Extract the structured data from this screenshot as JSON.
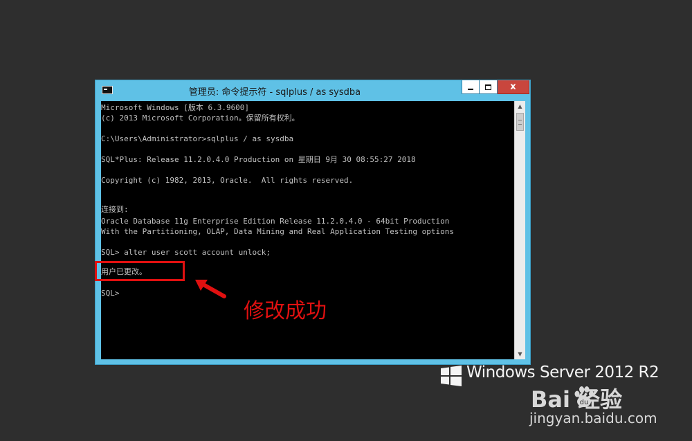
{
  "window": {
    "title": "管理员: 命令提示符 - sqlplus  / as sysdba",
    "controls": {
      "minimize": "minimize",
      "maximize": "maximize",
      "close": "x"
    }
  },
  "console": {
    "lines": [
      "Microsoft Windows [版本 6.3.9600]",
      "(c) 2013 Microsoft Corporation。保留所有权利。",
      "",
      "C:\\Users\\Administrator>sqlplus / as sysdba",
      "",
      "SQL*Plus: Release 11.2.0.4.0 Production on 星期日 9月 30 08:55:27 2018",
      "",
      "Copyright (c) 1982, 2013, Oracle.  All rights reserved.",
      "",
      "",
      "连接到:",
      "Oracle Database 11g Enterprise Edition Release 11.2.0.4.0 - 64bit Production",
      "With the Partitioning, OLAP, Data Mining and Real Application Testing options",
      "",
      "SQL> alter user scott account unlock;",
      "",
      "用户已更改。",
      "",
      "SQL>"
    ]
  },
  "annotation": {
    "text": "修改成功",
    "color": "#e01010"
  },
  "watermark": {
    "os_text": "Windows Server 2012 R2",
    "baidu_logo": "Bai  经验",
    "baidu_site": "jingyan.baidu.com"
  },
  "colors": {
    "window_frame": "#5fc1e6",
    "console_bg": "#000000",
    "console_text": "#c0c0c0",
    "close_button": "#c9463d"
  }
}
